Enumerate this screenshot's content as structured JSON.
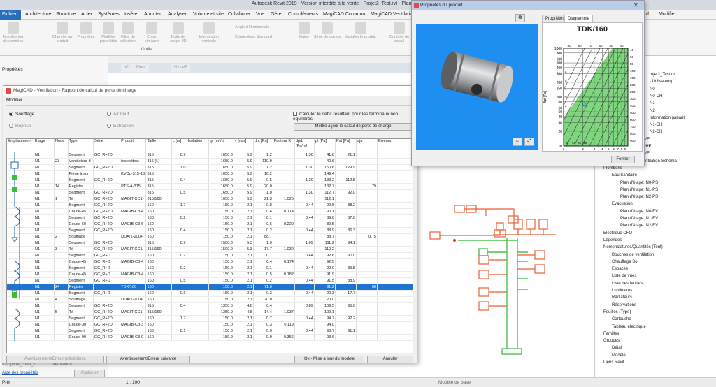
{
  "window": {
    "title": "Autodesk Revit 2019 - Version interdite à la vente - Projet2_Test.rvt - Plan d'"
  },
  "menu": {
    "items": [
      "Fichier",
      "Architecture",
      "Structure",
      "Acier",
      "Systèmes",
      "Insérer",
      "Annoter",
      "Analyser",
      "Volume et site",
      "Collaborer",
      "Vue",
      "Gérer",
      "Compléments",
      "MagiCAD Commun",
      "MagiCAD Ventilation"
    ],
    "right_item": "Modifier",
    "right_suffix": "d"
  },
  "ribbon": {
    "buttons": [
      "Modifier jeu de données",
      "Cherche un produit",
      "Propriétés",
      "Modifier propriétés",
      "Filtre de sélection",
      "Créer similaire",
      "Boîte de coupe 3D",
      "Intersection verticale",
      "Angle à l'horizontale",
      "Connexions Standard",
      "Gaine",
      "Série de gaines",
      "Installer le produit",
      "Contrôle de calcul"
    ],
    "group_label": "Outils"
  },
  "left_panel": {
    "header": "Propriétés",
    "bottom_label": "Aide des propriétés",
    "apply_button": "Appliquer",
    "field_label": "discipline_code_1",
    "field_value": "Ventilation"
  },
  "view_tabs": {
    "tabs": [
      "N0 - 1 Floor",
      "N1 -VE"
    ]
  },
  "statusbar": {
    "left": "Prêt",
    "scale": "1 : 100",
    "model": "Modèle de base"
  },
  "browser": {
    "items": [
      {
        "text": "rojet2_Test.rvt",
        "indent": 0
      },
      {
        "text": "- Utilisateur)",
        "indent": 0
      },
      {
        "text": "N0",
        "indent": 0
      },
      {
        "text": "N0-CH",
        "indent": 0
      },
      {
        "text": "N1",
        "indent": 0
      },
      {
        "text": "N2",
        "indent": 0
      },
      {
        "text": "Information gabarit",
        "indent": 0
      },
      {
        "text": "N1-CH",
        "indent": 0
      },
      {
        "text": "N2-CH",
        "indent": 0
      },
      {
        "text": "Plan d'étage: N0-VE",
        "indent": 1
      },
      {
        "text": "Plan d'étage: N1-VE",
        "indent": 1,
        "bold": true
      },
      {
        "text": "Plan d'étage: N2-VE",
        "indent": 1
      },
      {
        "text": "Vue de dessin: Ventilation-Schéma",
        "indent": 1
      },
      {
        "text": "Plomberie",
        "indent": 0
      },
      {
        "text": "Eau Sanitaire",
        "indent": 1
      },
      {
        "text": "Plan d'étage: N0-PS",
        "indent": 2
      },
      {
        "text": "Plan d'étage: N1-PS",
        "indent": 2
      },
      {
        "text": "Plan d'étage: N2-PS",
        "indent": 2
      },
      {
        "text": "Evacuation",
        "indent": 1
      },
      {
        "text": "Plan d'étage: N0-EV",
        "indent": 2
      },
      {
        "text": "Plan d'étage: N1-EV",
        "indent": 2
      },
      {
        "text": "Plan d'étage: N2-EV",
        "indent": 2
      },
      {
        "text": "Electrique CFO",
        "indent": 0
      },
      {
        "text": "Légendes",
        "indent": 0
      },
      {
        "text": "Nomenclatures/Quantités (Tout)",
        "indent": 0
      },
      {
        "text": "Bouches de ventilation",
        "indent": 1
      },
      {
        "text": "Chauffage Sol",
        "indent": 1
      },
      {
        "text": "Espaces",
        "indent": 1
      },
      {
        "text": "Liste de vues",
        "indent": 1
      },
      {
        "text": "Liste des feuilles",
        "indent": 1
      },
      {
        "text": "Luminaires",
        "indent": 1
      },
      {
        "text": "Radiateurs",
        "indent": 1
      },
      {
        "text": "Réservations",
        "indent": 1
      },
      {
        "text": "Feuilles (Type)",
        "indent": 0
      },
      {
        "text": "Cartouche",
        "indent": 1
      },
      {
        "text": "Tableau électrique",
        "indent": 1
      },
      {
        "text": "Familles",
        "indent": 0
      },
      {
        "text": "Groupes",
        "indent": 0
      },
      {
        "text": "Détail",
        "indent": 1
      },
      {
        "text": "Modèle",
        "indent": 1
      },
      {
        "text": "Liens Revit",
        "indent": 0
      }
    ]
  },
  "dialog": {
    "title": "MagiCAD - Ventilation - Rapport de calcul de perte de charge",
    "menu": "Modifier",
    "radios": {
      "soufflage": "Soufflage",
      "reprise": "Reprise",
      "air_neuf": "Air neuf",
      "extraction": "Extraction"
    },
    "checkbox": "Calculer le débit résultant pour les terminaux non équilibrés",
    "update_button": "Mettre à jour le calcul de perte de charge",
    "buttons": {
      "prev": "Avertissement/Erreur précédente",
      "next": "Avertissement/Erreur suivante",
      "ok": "Ok - Mise à jour du modèle",
      "cancel": "Annuler"
    },
    "columns": [
      "Emplacement",
      "Étage",
      "Node",
      "Type",
      "Série",
      "Produit",
      "Taille",
      "L [m]",
      "Isolation",
      "qv [m³/h]",
      "v [m/s]",
      "dpt [Pa]",
      "Facteur K",
      "dp/L [Pa/m]",
      "pt [Pa]",
      "Pst [Pa]",
      "aju",
      "Erreurs"
    ],
    "rows": [
      [
        "N1",
        "",
        "Segment",
        "GC_R+2D",
        "",
        "315",
        "0.9",
        "",
        "1650.0",
        "5.9",
        "1.2",
        "",
        "1.30",
        "41.8",
        "21.1",
        "",
        ""
      ],
      [
        "N1",
        "23",
        "Ventilateur d",
        "",
        "testesttest",
        "315 (L)",
        "",
        "",
        "1650.0",
        "5.9",
        "-110.0",
        "",
        "",
        "40.6",
        "",
        "",
        ""
      ],
      [
        "N1",
        "",
        "Segment",
        "GC_R+2D",
        "",
        "315",
        "1.0",
        "",
        "1650.0",
        "5.9",
        "1.2",
        "",
        "1.30",
        "150.6",
        "129.9",
        "",
        ""
      ],
      [
        "N1",
        "",
        "Piège à son",
        "",
        "KVDp-315-10",
        "315",
        "",
        "",
        "1650.0",
        "5.9",
        "16.2",
        "",
        "",
        "149.4",
        "",
        "",
        ""
      ],
      [
        "N1",
        "",
        "Segment",
        "GC_R+2D",
        "",
        "315",
        "0.4",
        "",
        "1650.0",
        "5.9",
        "0.5",
        "",
        "1.30",
        "133.2",
        "112.5",
        "",
        ""
      ],
      [
        "N1",
        "14",
        "Registre",
        "",
        "PTS-A-315",
        "315",
        "",
        "",
        "1650.0",
        "5.9",
        "20.0",
        "",
        "",
        "132.7",
        "",
        "79",
        ""
      ],
      [
        "N1",
        "",
        "Segment",
        "GC_R+2D",
        "",
        "315",
        "0.5",
        "",
        "1650.0",
        "5.9",
        "1.0",
        "",
        "1.30",
        "112.7",
        "92.0",
        "",
        ""
      ],
      [
        "N1",
        "1",
        "Té",
        "GC_R+2D",
        "MAGIT-CC1-",
        "315/160",
        "",
        "",
        "1650.0",
        "5.9",
        "21.3",
        "1.025",
        "",
        "112.1",
        "",
        "",
        ""
      ],
      [
        "N1",
        "",
        "Segment",
        "GC_R+2D",
        "",
        "160",
        "1.7",
        "",
        "150.0",
        "2.1",
        "0.8",
        "",
        "0.44",
        "90.8",
        "88.2",
        "",
        ""
      ],
      [
        "N1",
        "",
        "Coude-45",
        "GC_R+2D",
        "MAGIB-C3-4",
        "160",
        "",
        "",
        "150.0",
        "2.1",
        "0.4",
        "0.174",
        "",
        "90.1",
        "",
        "",
        ""
      ],
      [
        "N1",
        "",
        "Segment",
        "GC_R+2D",
        "",
        "160",
        "0.2",
        "",
        "150.0",
        "2.1",
        "0.1",
        "",
        "0.44",
        "89.6",
        "87.0",
        "",
        ""
      ],
      [
        "N1",
        "",
        "Coude-60",
        "GC_R+2D",
        "MAGIB-C3-6",
        "160",
        "",
        "",
        "150.0",
        "2.1",
        "0.6",
        "0.229",
        "",
        "89.5",
        "",
        "",
        ""
      ],
      [
        "N1",
        "",
        "Segment",
        "GC_R+2D",
        "",
        "160",
        "0.4",
        "",
        "150.0",
        "2.1",
        "0.2",
        "",
        "0.44",
        "88.9",
        "86.3",
        "",
        ""
      ],
      [
        "N1",
        "2",
        "Soufflage",
        "",
        "DDA/1-200+",
        "160",
        "",
        "",
        "150.0",
        "2.1",
        "88.7",
        "",
        "",
        "88.7",
        "",
        "0,75",
        ""
      ],
      [
        "N1",
        "",
        "Segment",
        "GC_R+2D",
        "",
        "315",
        "0.9",
        "",
        "1500.0",
        "5.3",
        "1.0",
        "",
        "1.09",
        "111.2",
        "94.1",
        "",
        ""
      ],
      [
        "N1",
        "3",
        "Té",
        "GC_R+2D",
        "MAGIT-CC1-",
        "315/160",
        "",
        "",
        "1500.0",
        "5.3",
        "17.7",
        "1.030",
        "",
        "110.2",
        "",
        "",
        ""
      ],
      [
        "N1",
        "",
        "Segment",
        "GC_R+D",
        "",
        "160",
        "0.2",
        "",
        "150.0",
        "2.1",
        "0.1",
        "",
        "0.44",
        "92.6",
        "90.0",
        "",
        ""
      ],
      [
        "N1",
        "",
        "Coude-45",
        "GC_R+D",
        "MAGIB-C3-4",
        "160",
        "",
        "",
        "150.0",
        "2.1",
        "0.4",
        "0.174",
        "",
        "92.5",
        "",
        "",
        ""
      ],
      [
        "N1",
        "",
        "Segment",
        "GC_R+D",
        "",
        "160",
        "0.2",
        "",
        "150.0",
        "2.1",
        "0.1",
        "",
        "0.44",
        "92.0",
        "89.5",
        "",
        ""
      ],
      [
        "N1",
        "",
        "Coude-45",
        "GC_R+D",
        "MAGIB-C3-4",
        "160",
        "",
        "",
        "150.0",
        "2.1",
        "0.5",
        "0.182",
        "",
        "91.9",
        "",
        "",
        ""
      ],
      [
        "N1",
        "",
        "Segment",
        "GC_R+D",
        "",
        "160",
        "0.5",
        "",
        "150.0",
        "2.1",
        "0.2",
        "",
        "0.44",
        "91.5",
        "88.9",
        "",
        ""
      ],
      [
        "N1",
        "24",
        "Registre",
        "",
        "TDK/160",
        "160",
        "",
        "",
        "150.0",
        "2.1",
        "71.0",
        "",
        "",
        "91.2",
        "",
        "56",
        ""
      ],
      [
        "N1",
        "",
        "Segment",
        "GC_R+D",
        "",
        "160",
        "0.6",
        "",
        "150.0",
        "2.1",
        "0.3",
        "",
        "0.44",
        "20.3",
        "17.7",
        "",
        ""
      ],
      [
        "N1",
        "4",
        "Soufflage",
        "",
        "DDA/1-200+",
        "160",
        "",
        "",
        "150.0",
        "2.1",
        "20.0",
        "",
        "",
        "20.0",
        "",
        "",
        ""
      ],
      [
        "N1",
        "",
        "Segment",
        "GC_R+2D",
        "",
        "315",
        "0.4",
        "",
        "1350.0",
        "4.8",
        "0.4",
        "",
        "0.89",
        "109.5",
        "95.6",
        "",
        ""
      ],
      [
        "N1",
        "5",
        "Té",
        "GC_R+2D",
        "MAGIT-CC1-",
        "315/160",
        "",
        "",
        "1350.0",
        "4.8",
        "14.4",
        "1.037",
        "",
        "109.1",
        "",
        "",
        ""
      ],
      [
        "N1",
        "",
        "Segment",
        "GC_R+2D",
        "",
        "160",
        "1.7",
        "",
        "150.0",
        "2.1",
        "0.7",
        "",
        "0.44",
        "94.7",
        "92.2",
        "",
        ""
      ],
      [
        "N1",
        "",
        "Coude-30",
        "GC_R+2D",
        "MAGIB-C3-3",
        "160",
        "",
        "",
        "150.0",
        "2.1",
        "0.3",
        "0.119",
        "",
        "94.0",
        "",
        "",
        ""
      ],
      [
        "N1",
        "",
        "Segment",
        "GC_R+2D",
        "",
        "160",
        "0.1",
        "",
        "150.0",
        "2.1",
        "0.0",
        "",
        "0.44",
        "93.7",
        "91.1",
        "",
        ""
      ],
      [
        "N1",
        "",
        "Coude-90",
        "GC_R+2D",
        "MAGIB-C3-9",
        "160",
        "",
        "",
        "150.0",
        "2.1",
        "0.9",
        "0.356",
        "",
        "93.6",
        "",
        "",
        ""
      ]
    ],
    "highlight_row": 21
  },
  "product": {
    "title": "Propriétés du produit",
    "tabs": [
      "Propriétés",
      "Diagramme"
    ],
    "close_button": "Fermer",
    "chart_data": {
      "type": "line",
      "title": "TDK/160",
      "xlabel": "v [m/s]",
      "ylabel": "Δpt [Pa]",
      "x_ticks": [
        "1",
        "2",
        "3",
        "4",
        "5",
        "6",
        "7",
        "8",
        "9",
        "10"
      ],
      "y_ticks": [
        "10",
        "20",
        "30",
        "40",
        "50",
        "60",
        "80",
        "100",
        "150",
        "200",
        "300",
        "400",
        "500",
        "600",
        "800",
        "1000"
      ],
      "right_ticks": [
        "40",
        "60",
        "80",
        "100",
        "150",
        "200",
        "250",
        "300",
        "400",
        "500",
        "600",
        "700",
        "800",
        "900"
      ],
      "top_ticks": [
        "90",
        "80",
        "70",
        "60",
        "50",
        "40"
      ],
      "bottom_ticks": [
        "0",
        "10",
        "20",
        "30"
      ],
      "left_ticks": [
        "1",
        "2",
        "3",
        "4",
        "5",
        "6"
      ],
      "operating_point": {
        "v": 2.1,
        "dpt": 71.0
      },
      "fill_color": "#7fd67f"
    }
  }
}
